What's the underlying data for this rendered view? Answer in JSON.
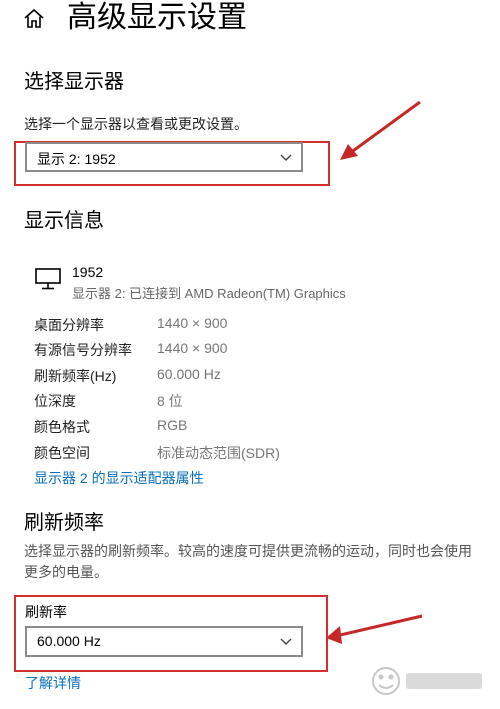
{
  "header": {
    "title": "高级显示设置",
    "icon": "home-icon"
  },
  "select_display": {
    "title": "选择显示器",
    "description": "选择一个显示器以查看或更改设置。",
    "dropdown_value": "显示 2: 1952"
  },
  "display_info": {
    "title": "显示信息",
    "monitor_name": "1952",
    "monitor_sub": "显示器 2: 已连接到 AMD Radeon(TM) Graphics",
    "rows": [
      {
        "label": "桌面分辨率",
        "value": "1440 × 900"
      },
      {
        "label": "有源信号分辨率",
        "value": "1440 × 900"
      },
      {
        "label": "刷新频率(Hz)",
        "value": "60.000 Hz"
      },
      {
        "label": "位深度",
        "value": "8 位"
      },
      {
        "label": "颜色格式",
        "value": "RGB"
      },
      {
        "label": "颜色空间",
        "value": "标准动态范围(SDR)"
      }
    ],
    "adapter_link": "显示器 2 的显示适配器属性"
  },
  "refresh": {
    "title": "刷新频率",
    "description_line1": "选择显示器的刷新频率。较高的速度可提供更流畅的运动，同时也会使用",
    "description_line2": "更多的电量。",
    "rate_label": "刷新率",
    "rate_value": "60.000 Hz",
    "learn_more": "了解详情"
  },
  "colors": {
    "accent_link": "#0a6fb9",
    "highlight_red": "#d32f2f"
  }
}
